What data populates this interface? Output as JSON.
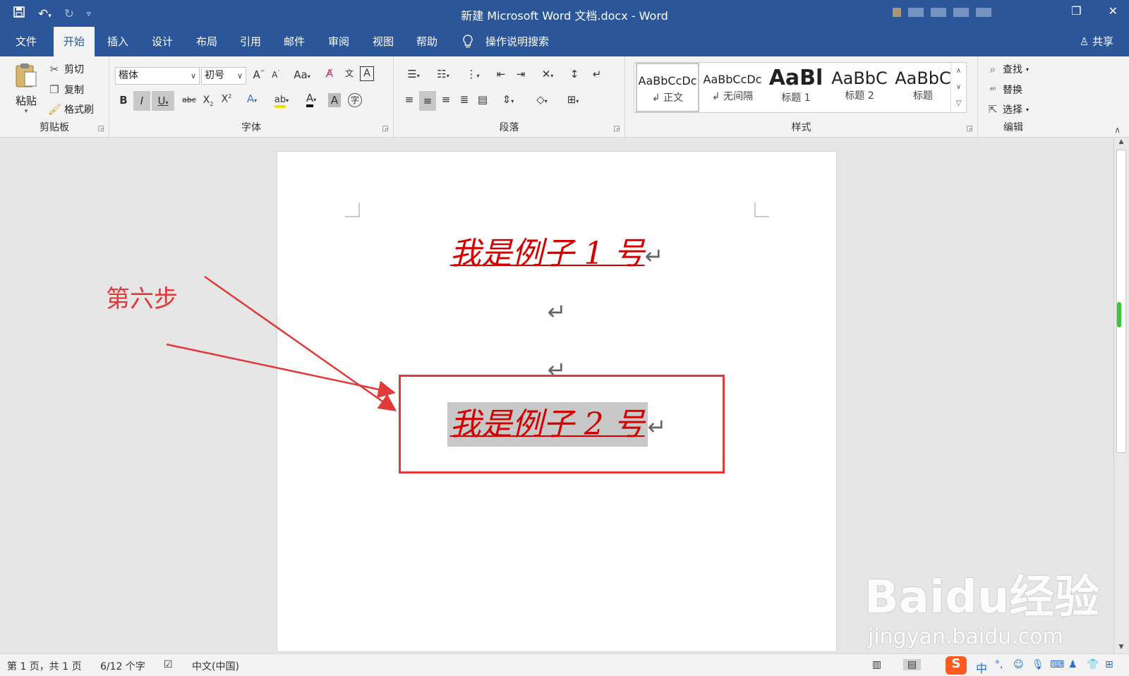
{
  "window": {
    "title": "新建 Microsoft Word 文档.docx  -  Word"
  },
  "tabs": [
    {
      "label": "文件"
    },
    {
      "label": "开始"
    },
    {
      "label": "插入"
    },
    {
      "label": "设计"
    },
    {
      "label": "布局"
    },
    {
      "label": "引用"
    },
    {
      "label": "邮件"
    },
    {
      "label": "审阅"
    },
    {
      "label": "视图"
    },
    {
      "label": "帮助"
    }
  ],
  "tell_me": "操作说明搜索",
  "share": "共享",
  "clipboard": {
    "paste": "粘贴",
    "cut": "剪切",
    "copy": "复制",
    "format_painter": "格式刷",
    "group_label": "剪贴板"
  },
  "font": {
    "family": "楷体",
    "size": "初号",
    "case_label": "Aa",
    "group_label": "字体"
  },
  "paragraph": {
    "group_label": "段落"
  },
  "styles": {
    "items": [
      {
        "sample": "AaBbCcDc",
        "name": "↲ 正文"
      },
      {
        "sample": "AaBbCcDc",
        "name": "↲ 无间隔"
      },
      {
        "sample": "AaBl",
        "name": "标题 1"
      },
      {
        "sample": "AaBbC",
        "name": "标题 2"
      },
      {
        "sample": "AaBbC",
        "name": "标题"
      }
    ],
    "group_label": "样式"
  },
  "editing": {
    "find": "查找",
    "replace": "替换",
    "select": "选择",
    "group_label": "编辑"
  },
  "document": {
    "line1": "我是例子 1 号",
    "line2": "我是例子 2 号",
    "para_mark": "↵"
  },
  "annotation": {
    "label": "第六步",
    "color": "#e03a3a"
  },
  "statusbar": {
    "page": "第 1 页，共 1 页",
    "words": "6/12 个字",
    "language": "中文(中国)",
    "ime": "中"
  },
  "watermark": {
    "main": "Baidu经验",
    "sub": "jingyan.baidu.com"
  },
  "colors": {
    "ribbon_blue": "#2b579a",
    "doc_text": "#d40000",
    "selection": "#c8c8c8"
  }
}
